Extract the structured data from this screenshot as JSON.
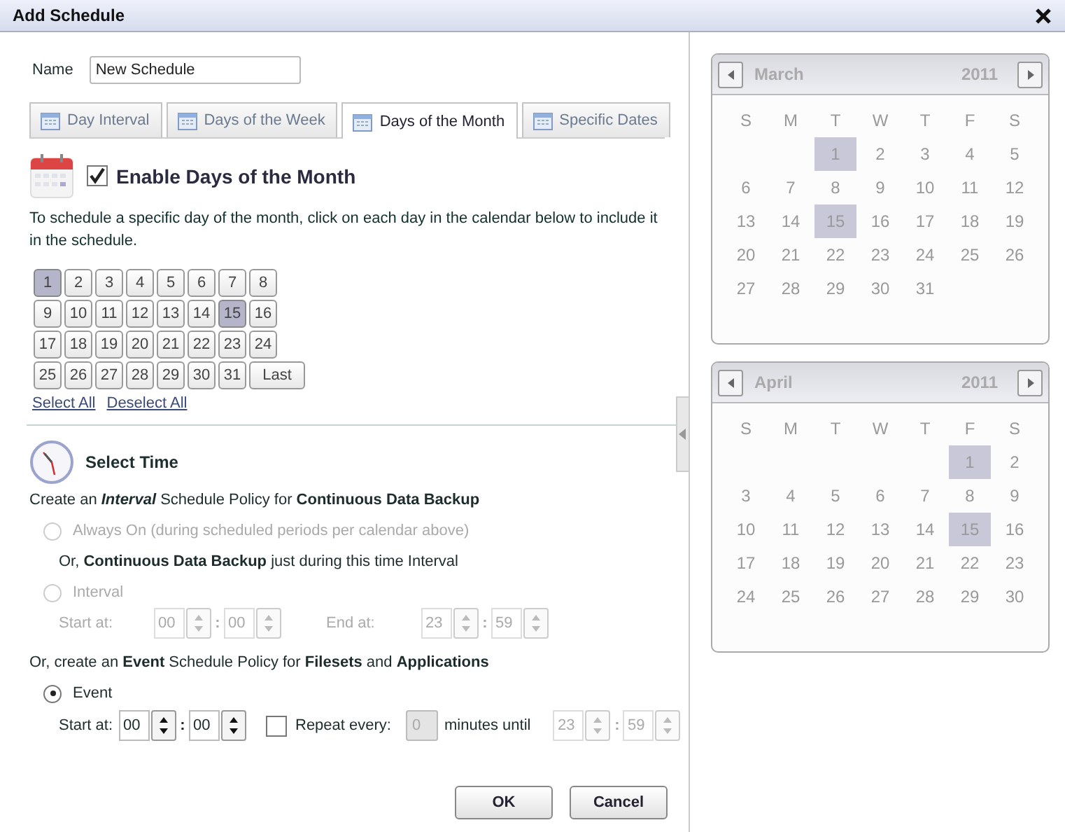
{
  "dialog": {
    "title": "Add Schedule"
  },
  "name_field": {
    "label": "Name",
    "value": "New Schedule"
  },
  "tabs": [
    {
      "label": "Day Interval",
      "selected": false
    },
    {
      "label": "Days of the Week",
      "selected": false
    },
    {
      "label": "Days of the Month",
      "selected": true
    },
    {
      "label": "Specific Dates",
      "selected": false
    }
  ],
  "enable": {
    "label": "Enable Days of the Month",
    "checked": true
  },
  "instructions": "To schedule a specific day of the month, click on each day in the calendar below to include it in the schedule.",
  "day_buttons": [
    {
      "label": "1",
      "selected": true
    },
    {
      "label": "2",
      "selected": false
    },
    {
      "label": "3",
      "selected": false
    },
    {
      "label": "4",
      "selected": false
    },
    {
      "label": "5",
      "selected": false
    },
    {
      "label": "6",
      "selected": false
    },
    {
      "label": "7",
      "selected": false
    },
    {
      "label": "8",
      "selected": false
    },
    {
      "label": "9",
      "selected": false
    },
    {
      "label": "10",
      "selected": false
    },
    {
      "label": "11",
      "selected": false
    },
    {
      "label": "12",
      "selected": false
    },
    {
      "label": "13",
      "selected": false
    },
    {
      "label": "14",
      "selected": false
    },
    {
      "label": "15",
      "selected": true
    },
    {
      "label": "16",
      "selected": false
    },
    {
      "label": "17",
      "selected": false
    },
    {
      "label": "18",
      "selected": false
    },
    {
      "label": "19",
      "selected": false
    },
    {
      "label": "20",
      "selected": false
    },
    {
      "label": "21",
      "selected": false
    },
    {
      "label": "22",
      "selected": false
    },
    {
      "label": "23",
      "selected": false
    },
    {
      "label": "24",
      "selected": false
    },
    {
      "label": "25",
      "selected": false
    },
    {
      "label": "26",
      "selected": false
    },
    {
      "label": "27",
      "selected": false
    },
    {
      "label": "28",
      "selected": false
    },
    {
      "label": "29",
      "selected": false
    },
    {
      "label": "30",
      "selected": false
    },
    {
      "label": "31",
      "selected": false
    },
    {
      "label": "Last",
      "selected": false
    }
  ],
  "links": [
    "Select All",
    "Deselect All"
  ],
  "select_time": {
    "title": "Select Time",
    "interval_heading": "Create an *Interval* Schedule Policy for **Continuous Data Backup**",
    "always_on": {
      "label": "Always On (during scheduled periods per calendar above)",
      "selected": false,
      "disabled": true
    },
    "interval_note": "Or, **Continuous Data Backup** just during this time Interval",
    "interval": {
      "label": "Interval",
      "selected": false,
      "disabled": true,
      "start_label": "Start at:",
      "start": {
        "hours": "00",
        "separator": ":",
        "minutes": "00"
      },
      "end_label": "End at:",
      "end": {
        "hours": "23",
        "separator": ":",
        "minutes": "59"
      }
    },
    "event_heading": "Or, create an **Event** Schedule Policy for **Filesets** and **Applications**",
    "event": {
      "label": "Event",
      "selected": true,
      "disabled": false,
      "start_label": "Start at:",
      "start": {
        "hours": "00",
        "separator": ":",
        "minutes": "00"
      },
      "repeat": {
        "label": "Repeat every:",
        "checked": false,
        "value": "0",
        "suffix": "minutes until",
        "until": {
          "hours": "23",
          "separator": ":",
          "minutes": "59"
        }
      }
    }
  },
  "buttons": [
    "OK",
    "Cancel"
  ],
  "calendars": [
    {
      "month": "March",
      "year": "2011",
      "weekdays": [
        "S",
        "M",
        "T",
        "W",
        "T",
        "F",
        "S"
      ],
      "weeks": [
        [
          {
            "kind": "blank"
          },
          {
            "kind": "blank"
          },
          {
            "kind": "day",
            "day": "1",
            "selected": true
          },
          {
            "kind": "day",
            "day": "2",
            "selected": false
          },
          {
            "kind": "day",
            "day": "3",
            "selected": false
          },
          {
            "kind": "day",
            "day": "4",
            "selected": false
          },
          {
            "kind": "day",
            "day": "5",
            "selected": false
          }
        ],
        [
          {
            "kind": "day",
            "day": "6",
            "selected": false
          },
          {
            "kind": "day",
            "day": "7",
            "selected": false
          },
          {
            "kind": "day",
            "day": "8",
            "selected": false
          },
          {
            "kind": "day",
            "day": "9",
            "selected": false
          },
          {
            "kind": "day",
            "day": "10",
            "selected": false
          },
          {
            "kind": "day",
            "day": "11",
            "selected": false
          },
          {
            "kind": "day",
            "day": "12",
            "selected": false
          }
        ],
        [
          {
            "kind": "day",
            "day": "13",
            "selected": false
          },
          {
            "kind": "day",
            "day": "14",
            "selected": false
          },
          {
            "kind": "day",
            "day": "15",
            "selected": true
          },
          {
            "kind": "day",
            "day": "16",
            "selected": false
          },
          {
            "kind": "day",
            "day": "17",
            "selected": false
          },
          {
            "kind": "day",
            "day": "18",
            "selected": false
          },
          {
            "kind": "day",
            "day": "19",
            "selected": false
          }
        ],
        [
          {
            "kind": "day",
            "day": "20",
            "selected": false
          },
          {
            "kind": "day",
            "day": "21",
            "selected": false
          },
          {
            "kind": "day",
            "day": "22",
            "selected": false
          },
          {
            "kind": "day",
            "day": "23",
            "selected": false
          },
          {
            "kind": "day",
            "day": "24",
            "selected": false
          },
          {
            "kind": "day",
            "day": "25",
            "selected": false
          },
          {
            "kind": "day",
            "day": "26",
            "selected": false
          }
        ],
        [
          {
            "kind": "day",
            "day": "27",
            "selected": false
          },
          {
            "kind": "day",
            "day": "28",
            "selected": false
          },
          {
            "kind": "day",
            "day": "29",
            "selected": false
          },
          {
            "kind": "day",
            "day": "30",
            "selected": false
          },
          {
            "kind": "day",
            "day": "31",
            "selected": false
          },
          {
            "kind": "blank"
          },
          {
            "kind": "blank"
          }
        ]
      ]
    },
    {
      "month": "April",
      "year": "2011",
      "weekdays": [
        "S",
        "M",
        "T",
        "W",
        "T",
        "F",
        "S"
      ],
      "weeks": [
        [
          {
            "kind": "blank"
          },
          {
            "kind": "blank"
          },
          {
            "kind": "blank"
          },
          {
            "kind": "blank"
          },
          {
            "kind": "blank"
          },
          {
            "kind": "day",
            "day": "1",
            "selected": true
          },
          {
            "kind": "day",
            "day": "2",
            "selected": false
          }
        ],
        [
          {
            "kind": "day",
            "day": "3",
            "selected": false
          },
          {
            "kind": "day",
            "day": "4",
            "selected": false
          },
          {
            "kind": "day",
            "day": "5",
            "selected": false
          },
          {
            "kind": "day",
            "day": "6",
            "selected": false
          },
          {
            "kind": "day",
            "day": "7",
            "selected": false
          },
          {
            "kind": "day",
            "day": "8",
            "selected": false
          },
          {
            "kind": "day",
            "day": "9",
            "selected": false
          }
        ],
        [
          {
            "kind": "day",
            "day": "10",
            "selected": false
          },
          {
            "kind": "day",
            "day": "11",
            "selected": false
          },
          {
            "kind": "day",
            "day": "12",
            "selected": false
          },
          {
            "kind": "day",
            "day": "13",
            "selected": false
          },
          {
            "kind": "day",
            "day": "14",
            "selected": false
          },
          {
            "kind": "day",
            "day": "15",
            "selected": true
          },
          {
            "kind": "day",
            "day": "16",
            "selected": false
          }
        ],
        [
          {
            "kind": "day",
            "day": "17",
            "selected": false
          },
          {
            "kind": "day",
            "day": "18",
            "selected": false
          },
          {
            "kind": "day",
            "day": "19",
            "selected": false
          },
          {
            "kind": "day",
            "day": "20",
            "selected": false
          },
          {
            "kind": "day",
            "day": "21",
            "selected": false
          },
          {
            "kind": "day",
            "day": "22",
            "selected": false
          },
          {
            "kind": "day",
            "day": "23",
            "selected": false
          }
        ],
        [
          {
            "kind": "day",
            "day": "24",
            "selected": false
          },
          {
            "kind": "day",
            "day": "25",
            "selected": false
          },
          {
            "kind": "day",
            "day": "26",
            "selected": false
          },
          {
            "kind": "day",
            "day": "27",
            "selected": false
          },
          {
            "kind": "day",
            "day": "28",
            "selected": false
          },
          {
            "kind": "day",
            "day": "29",
            "selected": false
          },
          {
            "kind": "day",
            "day": "30",
            "selected": false
          }
        ]
      ]
    }
  ]
}
